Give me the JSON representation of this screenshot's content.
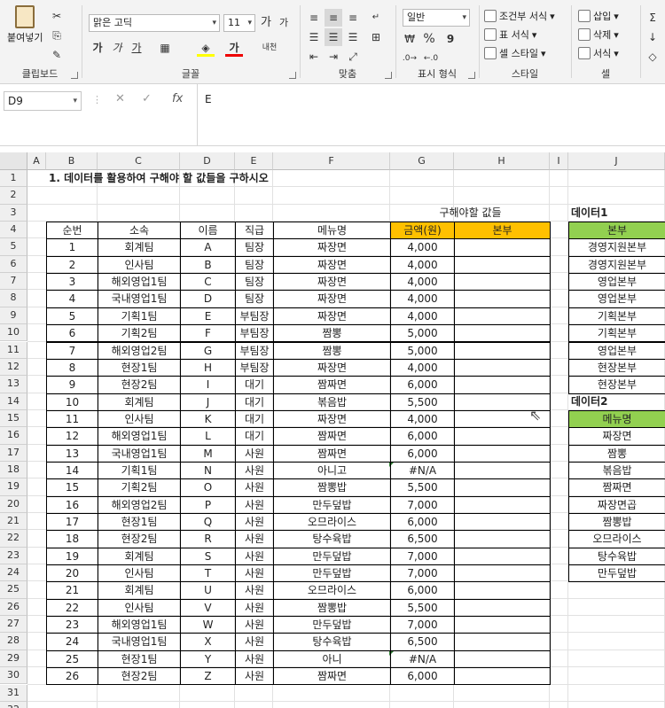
{
  "ribbon": {
    "clipboard": {
      "paste": "붙여넣기",
      "label": "클립보드"
    },
    "font": {
      "name": "맑은 고딕",
      "size": "11",
      "bold": "가",
      "italic": "가",
      "underline": "가",
      "grow": "가",
      "shrink": "가",
      "label": "글꼴"
    },
    "align": {
      "label": "맞춤"
    },
    "number": {
      "format": "일반",
      "percent": "%",
      "comma": "9",
      "label": "표시 형식"
    },
    "styles": {
      "conditional": "조건부 서식",
      "table": "표 서식",
      "cell": "셀 스타일",
      "label": "스타일"
    },
    "cells": {
      "insert": "삽입",
      "delete": "삭제",
      "format": "서식",
      "label": "셀"
    }
  },
  "formula_bar": {
    "name_box": "D9",
    "content": "E"
  },
  "columns": [
    "A",
    "B",
    "C",
    "D",
    "E",
    "F",
    "G",
    "H",
    "I",
    "J"
  ],
  "rows": [
    "1",
    "2",
    "3",
    "4",
    "5",
    "6",
    "7",
    "8",
    "9",
    "10",
    "11",
    "12",
    "13",
    "14",
    "15",
    "16",
    "17",
    "18",
    "19",
    "20",
    "21",
    "22",
    "23",
    "24",
    "25",
    "26",
    "27",
    "28",
    "29",
    "30",
    "31",
    "32"
  ],
  "sheet": {
    "title": "1. 데이터를 활용하여 구해야 할 값들을 구하시오",
    "find_label": "구해야할 값들",
    "headers": [
      "순번",
      "소속",
      "이름",
      "직급",
      "메뉴명",
      "금액(원)",
      "본부"
    ],
    "table": [
      [
        "1",
        "회계팀",
        "A",
        "팀장",
        "짜장면",
        "4,000",
        ""
      ],
      [
        "2",
        "인사팀",
        "B",
        "팀장",
        "짜장면",
        "4,000",
        ""
      ],
      [
        "3",
        "해외영업1팀",
        "C",
        "팀장",
        "짜장면",
        "4,000",
        ""
      ],
      [
        "4",
        "국내영업1팀",
        "D",
        "팀장",
        "짜장면",
        "4,000",
        ""
      ],
      [
        "5",
        "기획1팀",
        "E",
        "부팀장",
        "짜장면",
        "4,000",
        ""
      ],
      [
        "6",
        "기획2팀",
        "F",
        "부팀장",
        "짬뽕",
        "5,000",
        ""
      ],
      [
        "7",
        "해외영업2팀",
        "G",
        "부팀장",
        "짬뽕",
        "5,000",
        ""
      ],
      [
        "8",
        "현장1팀",
        "H",
        "부팀장",
        "짜장면",
        "4,000",
        ""
      ],
      [
        "9",
        "현장2팀",
        "I",
        "대기",
        "짬짜면",
        "6,000",
        ""
      ],
      [
        "10",
        "회계팀",
        "J",
        "대기",
        "볶음밥",
        "5,500",
        ""
      ],
      [
        "11",
        "인사팀",
        "K",
        "대기",
        "짜장면",
        "4,000",
        ""
      ],
      [
        "12",
        "해외영업1팀",
        "L",
        "대기",
        "짬짜면",
        "6,000",
        ""
      ],
      [
        "13",
        "국내영업1팀",
        "M",
        "사원",
        "짬짜면",
        "6,000",
        ""
      ],
      [
        "14",
        "기획1팀",
        "N",
        "사원",
        "아니고",
        "#N/A",
        ""
      ],
      [
        "15",
        "기획2팀",
        "O",
        "사원",
        "짬뽕밥",
        "5,500",
        ""
      ],
      [
        "16",
        "해외영업2팀",
        "P",
        "사원",
        "만두덮밥",
        "7,000",
        ""
      ],
      [
        "17",
        "현장1팀",
        "Q",
        "사원",
        "오므라이스",
        "6,000",
        ""
      ],
      [
        "18",
        "현장2팀",
        "R",
        "사원",
        "탕수육밥",
        "6,500",
        ""
      ],
      [
        "19",
        "회계팀",
        "S",
        "사원",
        "만두덮밥",
        "7,000",
        ""
      ],
      [
        "20",
        "인사팀",
        "T",
        "사원",
        "만두덮밥",
        "7,000",
        ""
      ],
      [
        "21",
        "회계팀",
        "U",
        "사원",
        "오므라이스",
        "6,000",
        ""
      ],
      [
        "22",
        "인사팀",
        "V",
        "사원",
        "짬뽕밥",
        "5,500",
        ""
      ],
      [
        "23",
        "해외영업1팀",
        "W",
        "사원",
        "만두덮밥",
        "7,000",
        ""
      ],
      [
        "24",
        "국내영업1팀",
        "X",
        "사원",
        "탕수육밥",
        "6,500",
        ""
      ],
      [
        "25",
        "현장1팀",
        "Y",
        "사원",
        "아니",
        "#N/A",
        ""
      ],
      [
        "26",
        "현장2팀",
        "Z",
        "사원",
        "짬짜면",
        "6,000",
        ""
      ]
    ],
    "data1_title": "데이터1",
    "data1_header": "본부",
    "data1": [
      "경영지원본부",
      "경영지원본부",
      "영업본부",
      "영업본부",
      "기획본부",
      "기획본부",
      "영업본부",
      "현장본부",
      "현장본부"
    ],
    "data2_title": "데이터2",
    "data2_header": "메뉴명",
    "data2": [
      "짜장면",
      "짬뽕",
      "볶음밥",
      "짬짜면",
      "짜장면곱",
      "짬뽕밥",
      "오므라이스",
      "탕수육밥",
      "만두덮밥"
    ]
  },
  "colors": {
    "yellow_header": "#ffc000",
    "green_header": "#92d050",
    "error_marker": "#2e7d32"
  }
}
